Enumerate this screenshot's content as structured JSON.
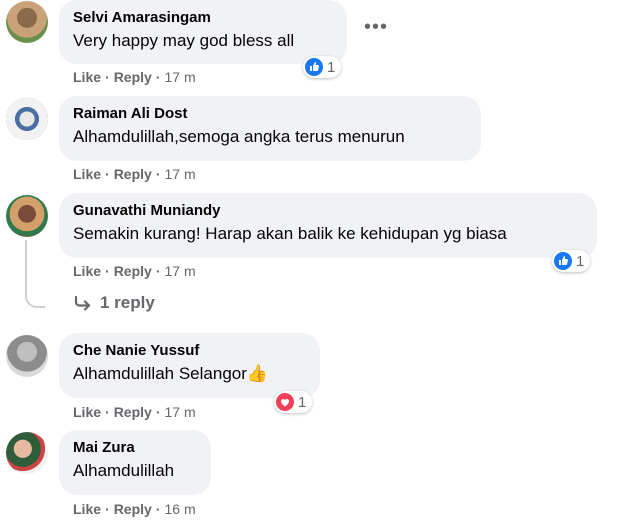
{
  "colors": {
    "bubble": "#f0f2f5",
    "muted": "#65676b",
    "like_blue": "#1877f2",
    "love_red": "#f33e58"
  },
  "comments": [
    {
      "author": "Selvi Amarasingam",
      "text": "Very happy may god bless all",
      "actions": {
        "like": "Like",
        "reply": "Reply",
        "time": "17 m"
      },
      "reaction": {
        "icon": "like-icon",
        "count": "1"
      }
    },
    {
      "author": "Raiman Ali Dost",
      "text": "Alhamdulillah,semoga angka terus menurun",
      "actions": {
        "like": "Like",
        "reply": "Reply",
        "time": "17 m"
      }
    },
    {
      "author": "Gunavathi Muniandy",
      "text": "Semakin kurang! Harap akan balik ke kehidupan yg biasa",
      "actions": {
        "like": "Like",
        "reply": "Reply",
        "time": "17 m"
      },
      "reaction": {
        "icon": "like-icon",
        "count": "1"
      },
      "replies_link": "1 reply"
    },
    {
      "author": "Che Nanie Yussuf",
      "text": "Alhamdulillah Selangor",
      "emoji": "👍",
      "actions": {
        "like": "Like",
        "reply": "Reply",
        "time": "17 m"
      },
      "reaction": {
        "icon": "love-icon",
        "count": "1"
      }
    },
    {
      "author": "Mai Zura",
      "text": "Alhamdulillah",
      "actions": {
        "like": "Like",
        "reply": "Reply",
        "time": "16 m"
      }
    }
  ]
}
